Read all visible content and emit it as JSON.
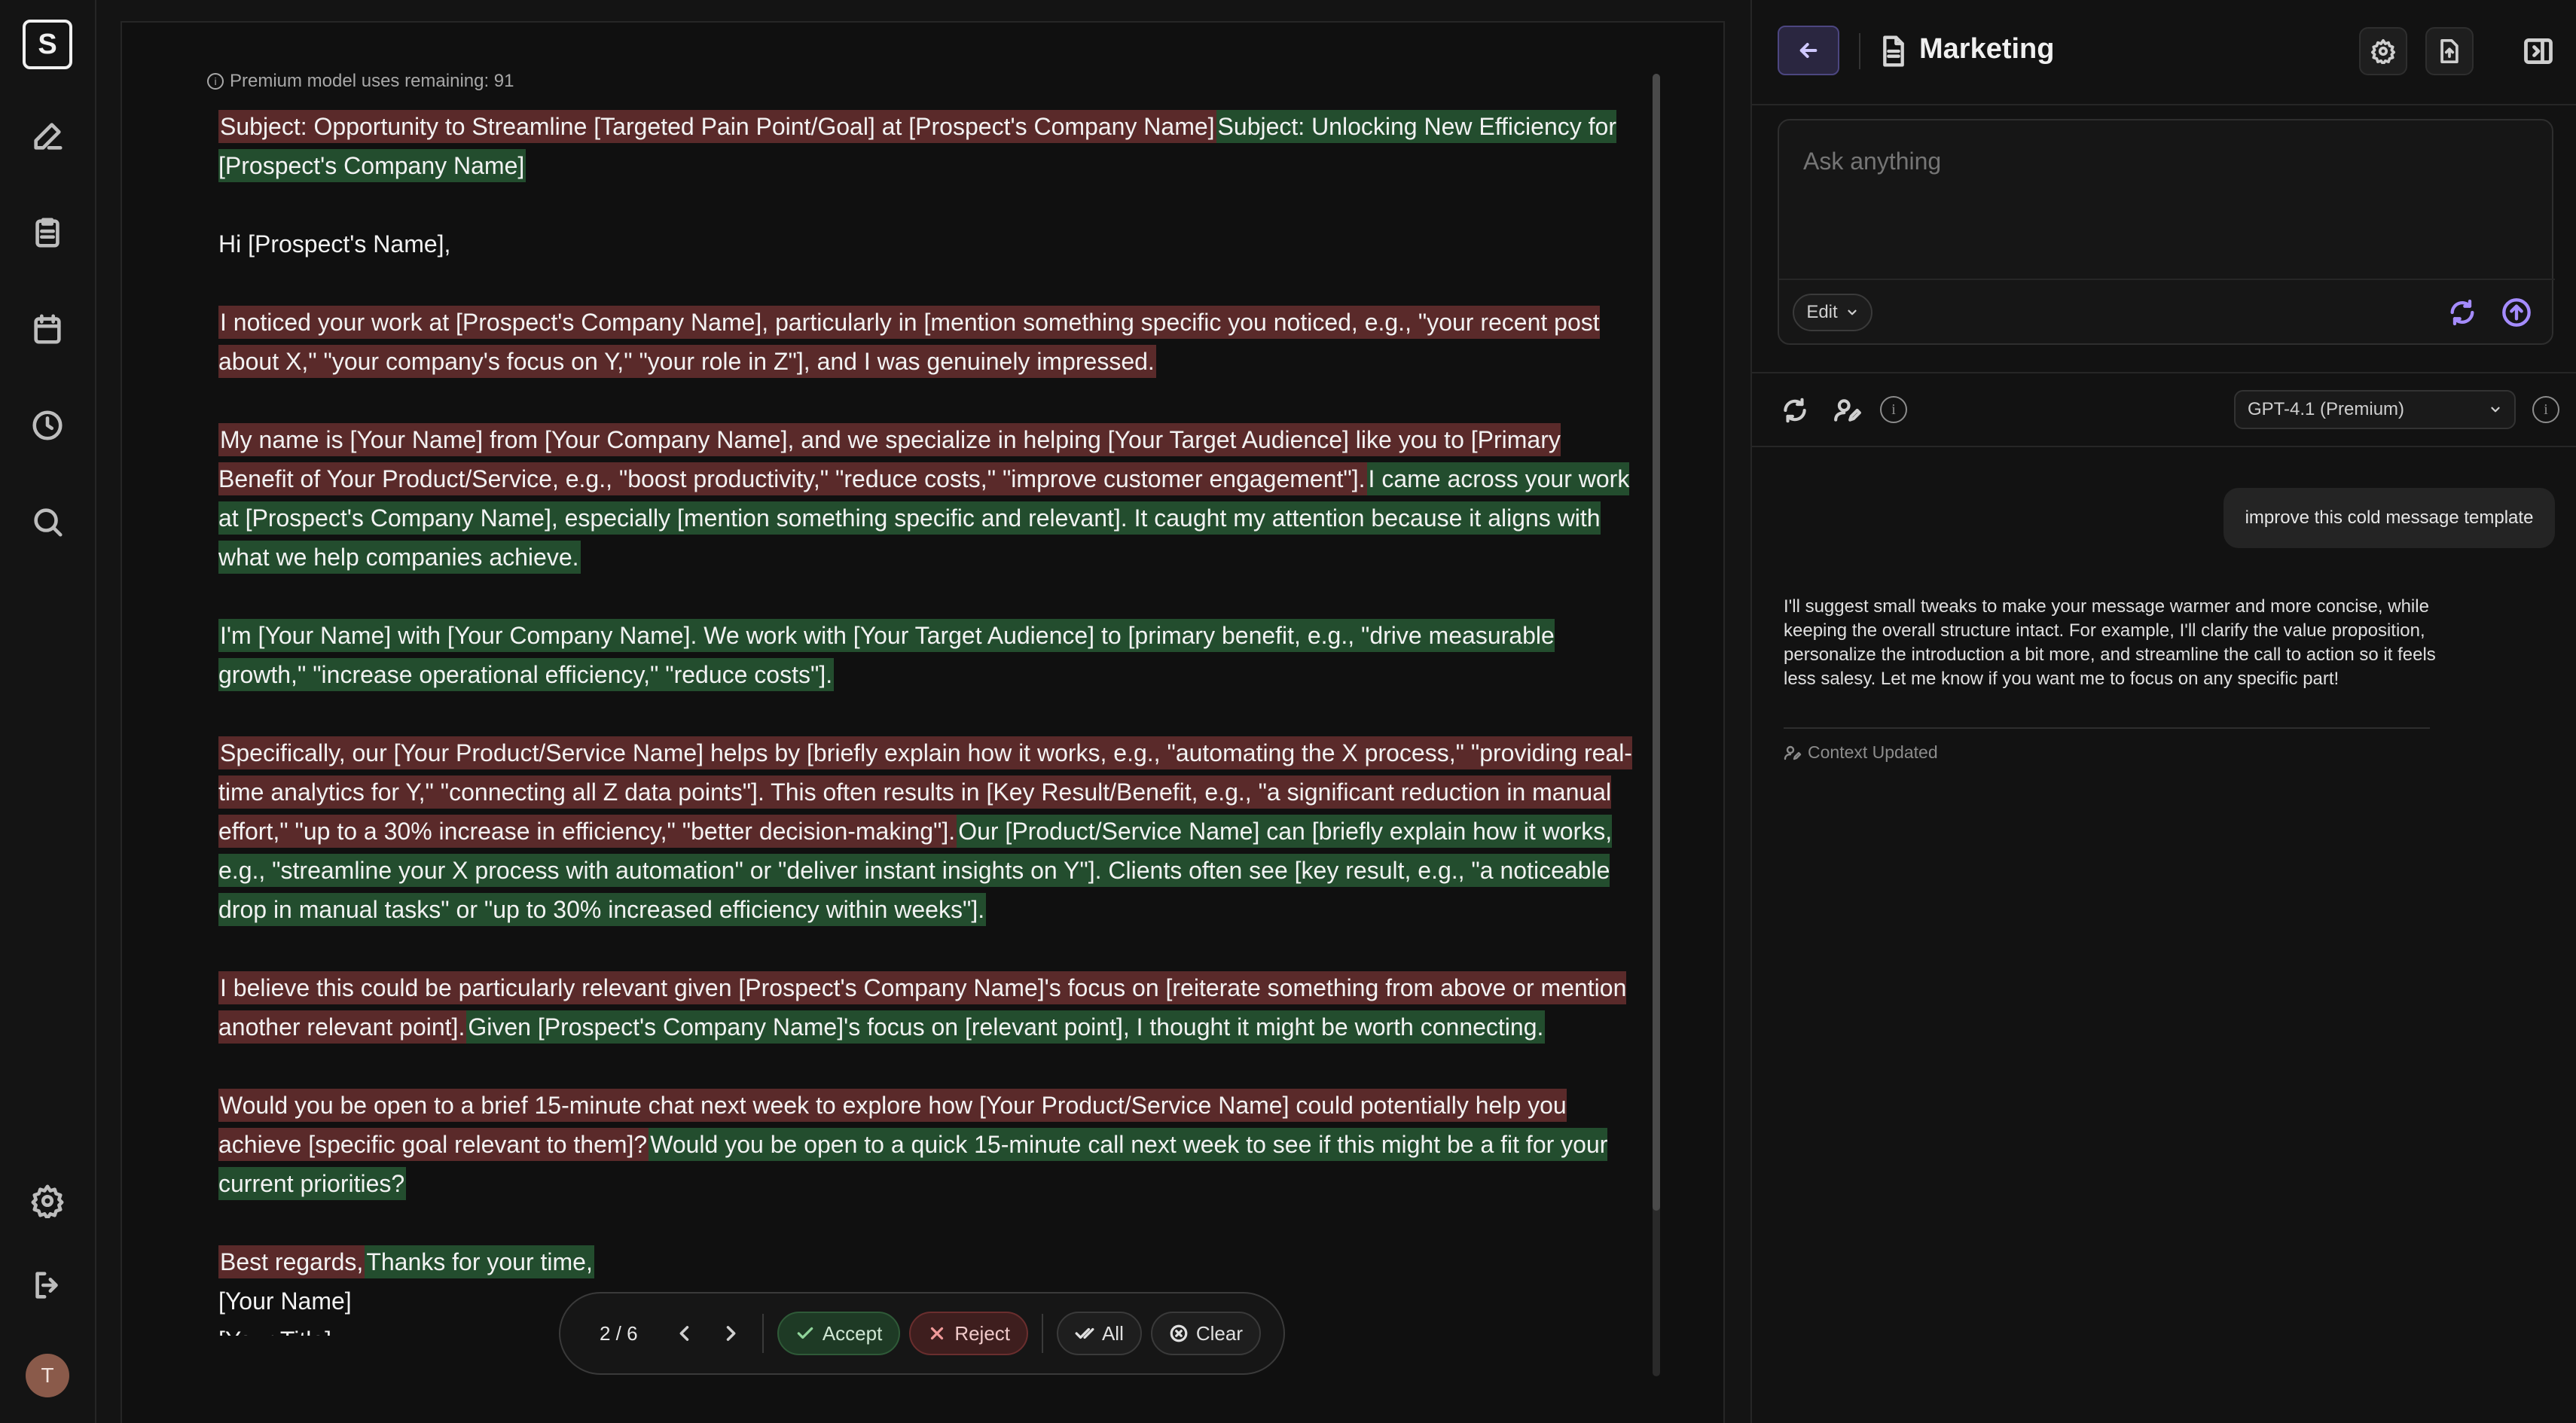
{
  "app": {
    "logo_letter": "S",
    "avatar_initial": "T"
  },
  "editor": {
    "premium_notice": "Premium model uses remaining: 91",
    "paragraphs": [
      {
        "del": "Subject: Opportunity to Streamline [Targeted Pain Point/Goal] at [Prospect's Company Name]",
        "ins": "Subject: Unlocking New Efficiency for [Prospect's Company Name]"
      },
      {
        "plain": "Hi [Prospect's Name],"
      },
      {
        "del": "I noticed your work at [Prospect's Company Name], particularly in [mention something specific you noticed, e.g., \"your recent post about X,\" \"your company's focus on Y,\" \"your role in Z\"], and I was genuinely impressed."
      },
      {
        "del": "My name is [Your Name] from [Your Company Name], and we specialize in helping [Your Target Audience] like you to [Primary Benefit of Your Product/Service, e.g., \"boost productivity,\" \"reduce costs,\" \"improve customer engagement\"].",
        "ins": "I came across your work at [Prospect's Company Name], especially [mention something specific and relevant]. It caught my attention because it aligns with what we help companies achieve."
      },
      {
        "ins": "I'm [Your Name] with [Your Company Name]. We work with [Your Target Audience] to [primary benefit, e.g., \"drive measurable growth,\" \"increase operational efficiency,\" \"reduce costs\"]."
      },
      {
        "del": "Specifically, our [Your Product/Service Name] helps by [briefly explain how it works, e.g., \"automating the X process,\" \"providing real-time analytics for Y,\" \"connecting all Z data points\"]. This often results in [Key Result/Benefit, e.g., \"a significant reduction in manual effort,\" \"up to a 30% increase in efficiency,\" \"better decision-making\"].",
        "ins": "Our [Product/Service Name] can [briefly explain how it works, e.g., \"streamline your X process with automation\" or \"deliver instant insights on Y\"]. Clients often see [key result, e.g., \"a noticeable drop in manual tasks\" or \"up to 30% increased efficiency within weeks\"]."
      },
      {
        "del": "I believe this could be particularly relevant given [Prospect's Company Name]'s focus on [reiterate something from above or mention another relevant point].",
        "ins": "Given [Prospect's Company Name]'s focus on [relevant point], I thought it might be worth connecting."
      },
      {
        "del": "Would you be open to a brief 15-minute chat next week to explore how [Your Product/Service Name] could potentially help you achieve [specific goal relevant to them]?",
        "ins": "Would you be open to a quick 15-minute call next week to see if this might be a fit for your current priorities?"
      }
    ],
    "closing_del": "Best regards,",
    "closing_ins": "Thanks for your time,",
    "signature_name": "[Your Name]",
    "signature_title": "[Your Title]"
  },
  "toolbar": {
    "count": "2 / 6",
    "accept": "Accept",
    "reject": "Reject",
    "all": "All",
    "clear": "Clear"
  },
  "panel": {
    "title": "Marketing",
    "ask_placeholder": "Ask anything",
    "edit_mode": "Edit",
    "model": "GPT-4.1 (Premium)",
    "user_message": "improve this cold message template",
    "assistant_message": "I'll suggest small tweaks to make your message warmer and more concise, while keeping the overall structure intact. For example, I'll clarify the value proposition, personalize the introduction a bit more, and streamline the call to action so it feels less salesy. Let me know if you want me to focus on any specific part!",
    "context_status": "Context Updated"
  },
  "colors": {
    "deleted_bg": "#5a2a2a",
    "inserted_bg": "#234d2e",
    "accent": "#a58cff"
  }
}
